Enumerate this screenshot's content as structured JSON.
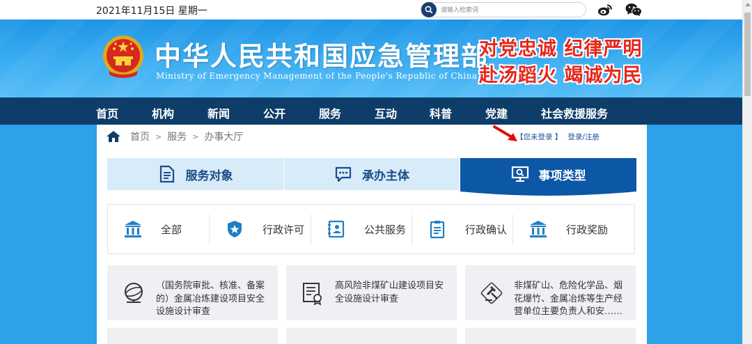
{
  "topbar": {
    "date": "2021年11月15日 星期一",
    "search_placeholder": "请输入检索词"
  },
  "header": {
    "title": "中华人民共和国应急管理部",
    "subtitle": "Ministry of Emergency Management of the People's Republic of China",
    "slogan_line1": "对党忠诚 纪律严明",
    "slogan_line2": "赴汤蹈火 竭诚为民"
  },
  "nav": {
    "items": [
      "首页",
      "机构",
      "新闻",
      "公开",
      "服务",
      "互动",
      "科普",
      "党建",
      "社会救援服务"
    ]
  },
  "breadcrumb": {
    "home": "首页",
    "service": "服务",
    "current": "办事大厅",
    "separator": ">"
  },
  "login": {
    "status": "【您未登录 】",
    "link": "登录/注册"
  },
  "tabs": {
    "items": [
      "服务对象",
      "承办主体",
      "事项类型"
    ],
    "active_index": 2
  },
  "categories": {
    "items": [
      "全部",
      "行政许可",
      "公共服务",
      "行政确认",
      "行政奖励"
    ]
  },
  "cards": {
    "items": [
      "（国务院审批、核准、备案的）金属冶炼建设项目安全设施设计审查",
      "高风险非煤矿山建设项目安全设施设计审查",
      "非煤矿山、危险化学品、烟花爆竹、金属冶炼等生产经营单位主要负责人和安……"
    ]
  },
  "colors": {
    "header_blue": "#2ea1ea",
    "nav_navy": "#0e3d69",
    "active_tab": "#0c57a6",
    "slogan_red": "#e8261c"
  }
}
